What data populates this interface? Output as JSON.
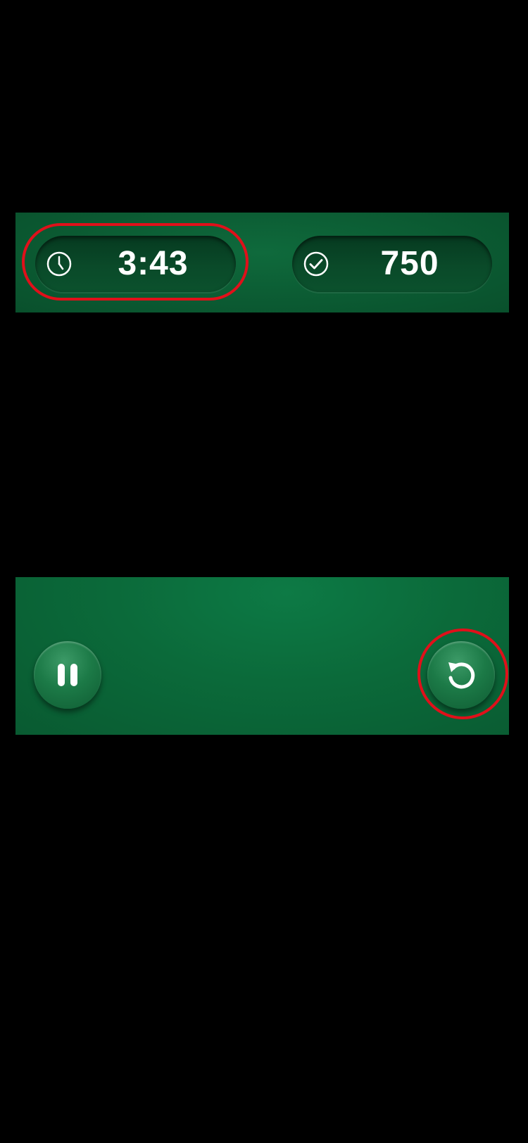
{
  "status_bar": {
    "timer": {
      "value": "3:43",
      "icon": "clock-icon"
    },
    "score": {
      "value": "750",
      "icon": "check-circle-icon"
    }
  },
  "controls": {
    "pause": {
      "icon": "pause-icon"
    },
    "undo": {
      "icon": "undo-icon"
    }
  },
  "colors": {
    "felt_green": "#0b6a3a",
    "pill_dark_green": "#08462a",
    "highlight_red": "#e0101a",
    "text_white": "#ffffff"
  }
}
